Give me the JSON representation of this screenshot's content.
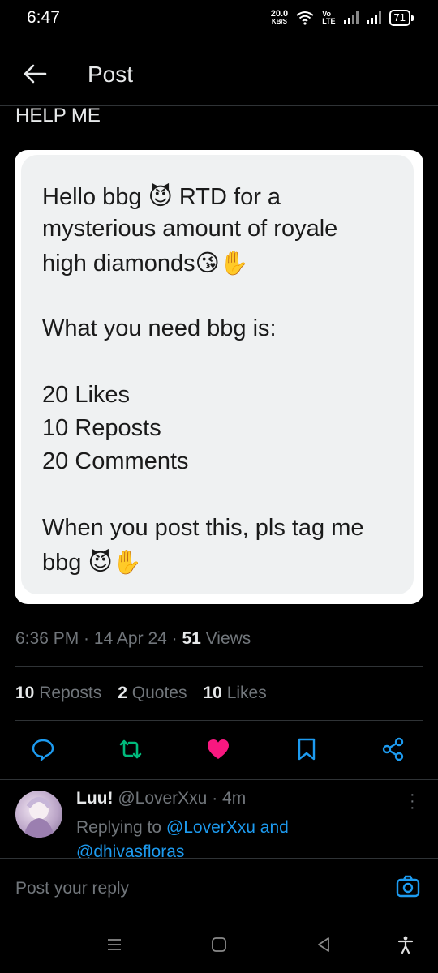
{
  "status": {
    "time": "6:47",
    "speed": "20.0",
    "speed_unit": "KB/S",
    "volte": "Vo\nLTE",
    "battery": "71"
  },
  "header": {
    "title": "Post"
  },
  "post": {
    "text_partial": "HELP ME",
    "image_lines": [
      "Hello bbg 😈 RTD for a",
      "mysterious amount of royale",
      "high diamonds😘✋",
      "What you need bbg is:",
      "20 Likes",
      "10 Reposts",
      "20 Comments",
      "When you post this, pls tag me",
      "bbg 😈✋"
    ],
    "time": "6:36 PM",
    "date": "14 Apr 24",
    "views_count": "51",
    "views_label": "Views"
  },
  "stats": {
    "reposts_count": "10",
    "reposts_label": "Reposts",
    "quotes_count": "2",
    "quotes_label": "Quotes",
    "likes_count": "10",
    "likes_label": "Likes"
  },
  "colors": {
    "accent": "#1d9bf0",
    "like": "#f91880",
    "repost": "#00ba7c",
    "muted": "#71767b"
  },
  "reply": {
    "name": "Luu!",
    "handle": "@LoverXxu",
    "time": "4m",
    "replying_prefix": "Replying to",
    "replying_users": "@LoverXxu and",
    "replying_users_2": "@dhivasfloras"
  },
  "composer": {
    "placeholder": "Post your reply"
  }
}
